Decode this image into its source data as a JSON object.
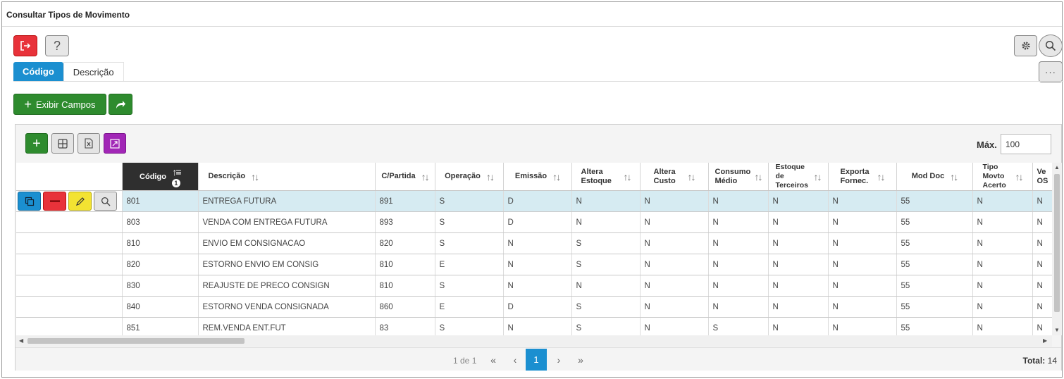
{
  "window": {
    "title": "Consultar Tipos de Movimento"
  },
  "toolbar": {
    "exit_icon": "exit-icon",
    "help_label": "?",
    "settings_icon": "gear-icon",
    "search_icon": "search-icon",
    "more_label": "···"
  },
  "tabs": [
    {
      "label": "Código",
      "active": true
    },
    {
      "label": "Descrição",
      "active": false
    }
  ],
  "actions": {
    "exibir_campos_label": "Exibir Campos",
    "share_icon": "share-icon"
  },
  "grid": {
    "max_label": "Máx.",
    "max_value": "100",
    "sort_badge": "1",
    "columns": [
      {
        "key": "codigo",
        "label": "Código",
        "sorted": true
      },
      {
        "key": "descricao",
        "label": "Descrição"
      },
      {
        "key": "cpartida",
        "label": "C/Partida"
      },
      {
        "key": "operacao",
        "label": "Operação"
      },
      {
        "key": "emissao",
        "label": "Emissão"
      },
      {
        "key": "altera_estoque",
        "label": "Altera Estoque"
      },
      {
        "key": "altera_custo",
        "label": "Altera Custo"
      },
      {
        "key": "consumo_medio",
        "label": "Consumo Médio"
      },
      {
        "key": "estoque_terceiros",
        "label": "Estoque de Terceiros"
      },
      {
        "key": "exporta_fornec",
        "label": "Exporta Fornec."
      },
      {
        "key": "mod_doc",
        "label": "Mod Doc"
      },
      {
        "key": "tipo_movto_acerto",
        "label": "Tipo Movto Acerto"
      },
      {
        "key": "ve_os",
        "label": "Ve OS"
      }
    ],
    "rows": [
      {
        "codigo": "801",
        "descricao": "ENTREGA FUTURA",
        "cpartida": "891",
        "operacao": "S",
        "emissao": "D",
        "altera_estoque": "N",
        "altera_custo": "N",
        "consumo_medio": "N",
        "estoque_terceiros": "N",
        "exporta_fornec": "N",
        "mod_doc": "55",
        "tipo_movto_acerto": "N",
        "ve_os": "N"
      },
      {
        "codigo": "803",
        "descricao": "VENDA COM ENTREGA FUTURA",
        "cpartida": "893",
        "operacao": "S",
        "emissao": "D",
        "altera_estoque": "N",
        "altera_custo": "N",
        "consumo_medio": "N",
        "estoque_terceiros": "N",
        "exporta_fornec": "N",
        "mod_doc": "55",
        "tipo_movto_acerto": "N",
        "ve_os": "N"
      },
      {
        "codigo": "810",
        "descricao": "ENVIO EM CONSIGNACAO",
        "cpartida": "820",
        "operacao": "S",
        "emissao": "N",
        "altera_estoque": "S",
        "altera_custo": "N",
        "consumo_medio": "N",
        "estoque_terceiros": "N",
        "exporta_fornec": "N",
        "mod_doc": "55",
        "tipo_movto_acerto": "N",
        "ve_os": "N"
      },
      {
        "codigo": "820",
        "descricao": "ESTORNO ENVIO EM CONSIG",
        "cpartida": "810",
        "operacao": "E",
        "emissao": "N",
        "altera_estoque": "S",
        "altera_custo": "N",
        "consumo_medio": "N",
        "estoque_terceiros": "N",
        "exporta_fornec": "N",
        "mod_doc": "55",
        "tipo_movto_acerto": "N",
        "ve_os": "N"
      },
      {
        "codigo": "830",
        "descricao": "REAJUSTE DE PRECO CONSIGN",
        "cpartida": "810",
        "operacao": "S",
        "emissao": "N",
        "altera_estoque": "N",
        "altera_custo": "N",
        "consumo_medio": "N",
        "estoque_terceiros": "N",
        "exporta_fornec": "N",
        "mod_doc": "55",
        "tipo_movto_acerto": "N",
        "ve_os": "N"
      },
      {
        "codigo": "840",
        "descricao": "ESTORNO VENDA CONSIGNADA",
        "cpartida": "860",
        "operacao": "E",
        "emissao": "D",
        "altera_estoque": "S",
        "altera_custo": "N",
        "consumo_medio": "N",
        "estoque_terceiros": "N",
        "exporta_fornec": "N",
        "mod_doc": "55",
        "tipo_movto_acerto": "N",
        "ve_os": "N"
      },
      {
        "codigo": "851",
        "descricao": "REM.VENDA ENT.FUT",
        "cpartida": "83",
        "operacao": "S",
        "emissao": "N",
        "altera_estoque": "S",
        "altera_custo": "N",
        "consumo_medio": "S",
        "estoque_terceiros": "N",
        "exporta_fornec": "N",
        "mod_doc": "55",
        "tipo_movto_acerto": "N",
        "ve_os": "N"
      },
      {
        "codigo": "",
        "descricao": "",
        "cpartida": "",
        "operacao": "",
        "emissao": "",
        "altera_estoque": "",
        "altera_custo": "",
        "consumo_medio": "",
        "estoque_terceiros": "",
        "exporta_fornec": "",
        "mod_doc": "",
        "tipo_movto_acerto": "",
        "ve_os": ""
      }
    ]
  },
  "pagination": {
    "page_info": "1 de 1",
    "first": "«",
    "prev": "‹",
    "current": "1",
    "next": "›",
    "last": "»",
    "total_label": "Total:",
    "total_value": "14"
  },
  "colors": {
    "primary": "#1b8fd0",
    "success": "#2e8b2e",
    "danger": "#e8323a",
    "warning": "#f3e332",
    "purple": "#a126b6",
    "selected_row": "#d6ebf2"
  }
}
